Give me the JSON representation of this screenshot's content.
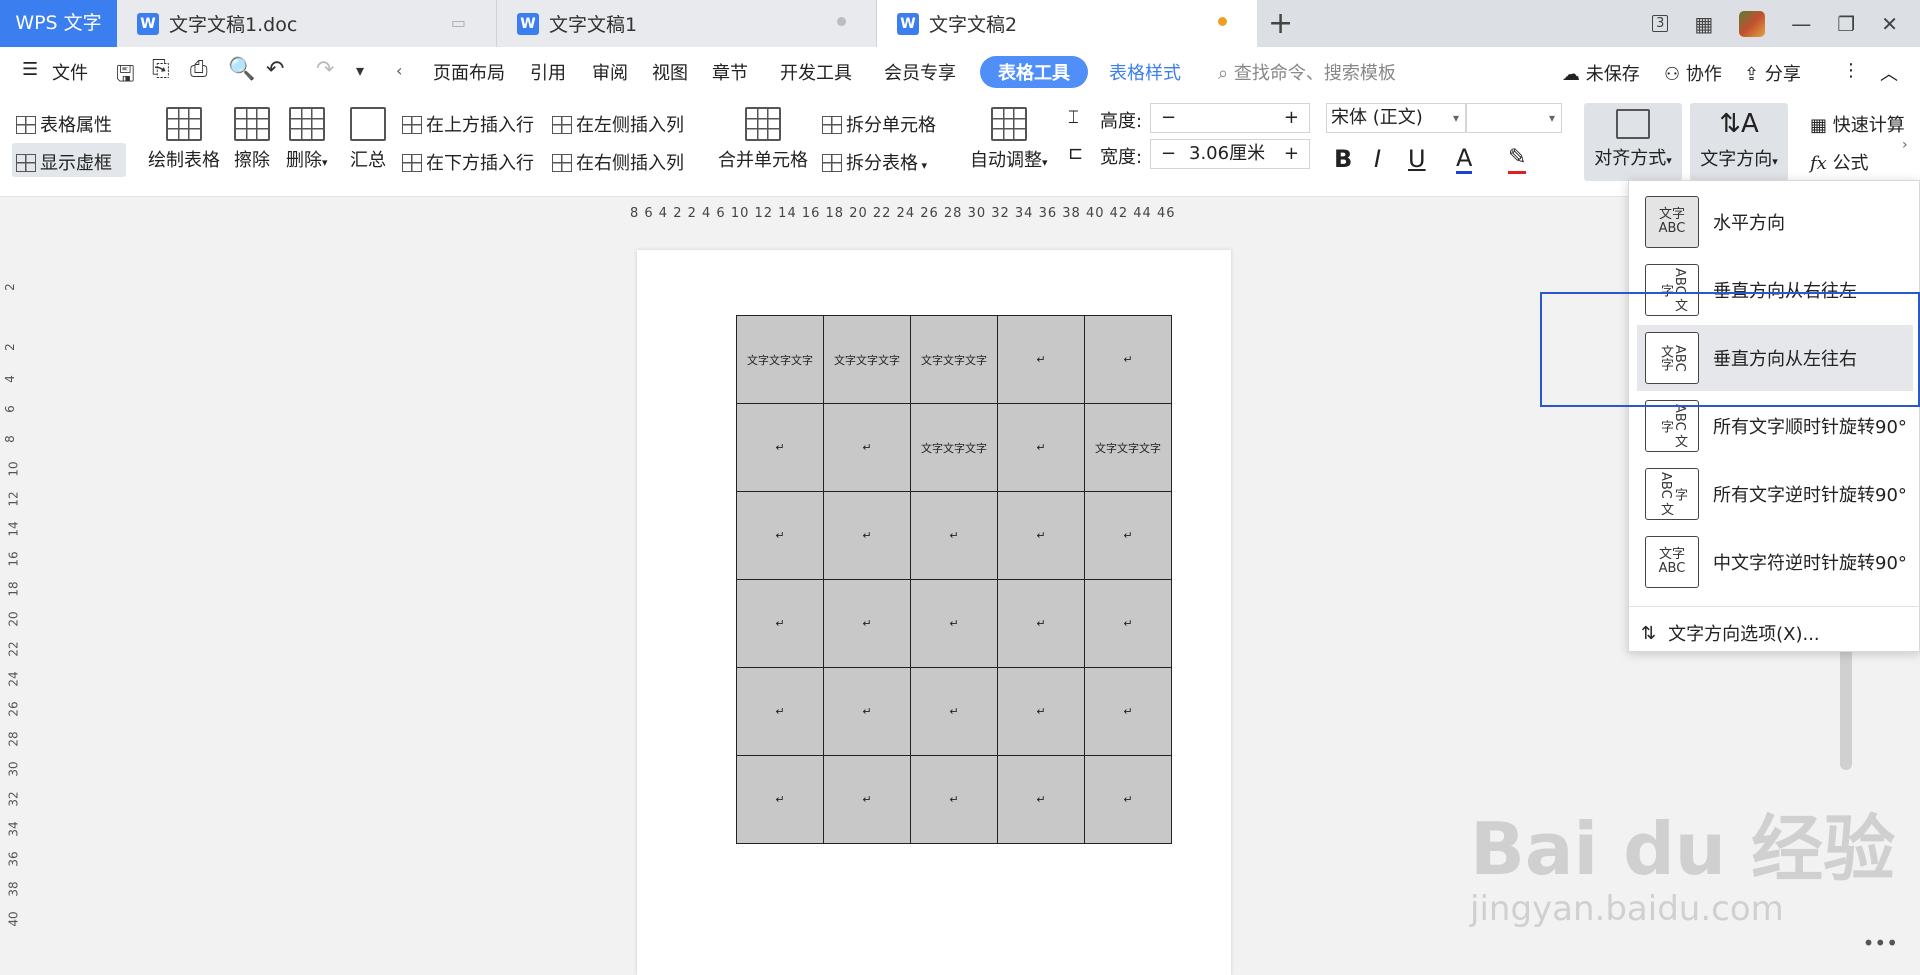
{
  "tabbar": {
    "app": "WPS 文字",
    "tabs": [
      {
        "label": "文字文稿1.doc"
      },
      {
        "label": "文字文稿1"
      },
      {
        "label": "文字文稿2"
      }
    ],
    "new_tab": "+",
    "layout_badge": "3",
    "window_controls": {
      "minimize": "—",
      "restore": "❐",
      "close": "✕"
    }
  },
  "menubar": {
    "file": "文件",
    "items": [
      "页面布局",
      "引用",
      "审阅",
      "视图",
      "章节",
      "开发工具",
      "会员专享"
    ],
    "active_tab": "表格工具",
    "style_tab": "表格样式",
    "search_placeholder": "查找命令、搜索模板",
    "unsaved": "未保存",
    "collab": "协作",
    "share": "分享"
  },
  "ribbon": {
    "table_props": "表格属性",
    "show_grid": "显示虚框",
    "draw_table": "绘制表格",
    "erase": "擦除",
    "delete": "删除",
    "summary": "汇总",
    "insert_above": "在上方插入行",
    "insert_below": "在下方插入行",
    "insert_left": "在左侧插入列",
    "insert_right": "在右侧插入列",
    "merge": "合并单元格",
    "split_cells": "拆分单元格",
    "split_table": "拆分表格",
    "auto_fit": "自动调整",
    "height_label": "高度:",
    "height_value": "",
    "width_label": "宽度:",
    "width_value": "3.06厘米",
    "minus": "−",
    "plus": "+",
    "font": "宋体 (正文)",
    "font_size": "",
    "bold": "B",
    "italic": "I",
    "underline": "U",
    "font_color": "A",
    "align": "对齐方式",
    "text_direction": "文字方向",
    "quick_calc": "快速计算",
    "formula": "公式",
    "formula_icon": "fx"
  },
  "ruler": {
    "horizontal": "8  6  4  2      2  4  6     10 12 14 16 18 20 22 24 26 28 30 32 34 36 38 40 42 44 46",
    "vertical": [
      "2",
      "2",
      "4",
      "6",
      "8",
      "10",
      "12",
      "14",
      "16",
      "18",
      "20",
      "22",
      "24",
      "26",
      "28",
      "30",
      "32",
      "34",
      "36",
      "38",
      "40"
    ]
  },
  "table": {
    "rows": [
      [
        "文字文字文字",
        "文字文字文字",
        "文字文字文字",
        "↵",
        "↵"
      ],
      [
        "↵",
        "↵",
        "文字文字文字",
        "↵",
        "文字文字文字"
      ],
      [
        "↵",
        "↵",
        "↵",
        "↵",
        "↵"
      ],
      [
        "↵",
        "↵",
        "↵",
        "↵",
        "↵"
      ],
      [
        "↵",
        "↵",
        "↵",
        "↵",
        "↵"
      ],
      [
        "↵",
        "↵",
        "↵",
        "↵",
        "↵"
      ]
    ]
  },
  "dropdown": {
    "items": [
      {
        "label": "水平方向",
        "icon_text": "文字 ABC"
      },
      {
        "label": "垂直方向从右往左",
        "icon_text": "ABC 文字"
      },
      {
        "label": "垂直方向从左往右",
        "icon_text": "文字 ABC"
      },
      {
        "label": "所有文字顺时针旋转90°",
        "icon_text": "ABC 文字"
      },
      {
        "label": "所有文字逆时针旋转90°",
        "icon_text": "ABC 文字"
      },
      {
        "label": "中文字符逆时针旋转90°",
        "icon_text": "文字 ABC"
      }
    ],
    "footer": "文字方向选项(X)..."
  },
  "watermark": {
    "line1": "Bai du 经验",
    "line2": "jingyan.baidu.com"
  },
  "colors": {
    "accent": "#3b7ef0",
    "annotation_box": "#2a58c9",
    "unsaved_dot": "#f0a020",
    "cell_fill": "#c8c8c8"
  }
}
